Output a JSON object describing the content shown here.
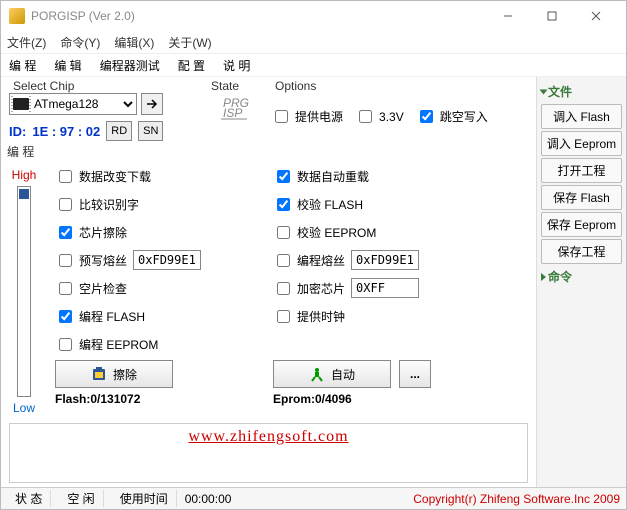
{
  "window": {
    "title": "PORGISP (Ver 2.0)"
  },
  "menu": {
    "file": "文件(Z)",
    "cmd": "命令(Y)",
    "edit": "编辑(X)",
    "about": "关于(W)"
  },
  "toolbar": {
    "prog": "编 程",
    "edit": "编  辑",
    "test": "编程器测试",
    "config": "配  置",
    "help": "说  明"
  },
  "chip": {
    "group": "Select Chip",
    "selected": "ATmega128",
    "idlabel": "ID:",
    "idvalue": "1E : 97 : 02",
    "rd": "RD",
    "sn": "SN"
  },
  "state": {
    "label": "State"
  },
  "options": {
    "label": "Options",
    "power": "提供电源",
    "v33": "3.3V",
    "skip": "跳空写入",
    "power_chk": false,
    "v33_chk": false,
    "skip_chk": true
  },
  "programming": {
    "title": "编 程",
    "high": "High",
    "low": "Low",
    "left": [
      {
        "label": "数据改变下载",
        "chk": false
      },
      {
        "label": "比较识别字",
        "chk": false
      },
      {
        "label": "芯片擦除",
        "chk": true
      },
      {
        "label": "预写熔丝",
        "chk": false,
        "val": "0xFD99E1"
      },
      {
        "label": "空片检查",
        "chk": false
      },
      {
        "label": "编程 FLASH",
        "chk": true
      },
      {
        "label": "编程 EEPROM",
        "chk": false
      }
    ],
    "right": [
      {
        "label": "数据自动重载",
        "chk": true
      },
      {
        "label": "校验 FLASH",
        "chk": true
      },
      {
        "label": "校验 EEPROM",
        "chk": false
      },
      {
        "label": "编程熔丝",
        "chk": false,
        "val": "0xFD99E1"
      },
      {
        "label": "加密芯片",
        "chk": false,
        "val": "0XFF"
      },
      {
        "label": "提供时钟",
        "chk": false
      }
    ],
    "erase": "擦除",
    "auto": "自动",
    "dots": "...",
    "flashstat": "Flash:0/131072",
    "epromstat": "Eprom:0/4096"
  },
  "url": "www.zhifengsoft.com",
  "side": {
    "files": "文件",
    "buttons": [
      "调入 Flash",
      "调入 Eeprom",
      "打开工程",
      "保存 Flash",
      "保存 Eeprom",
      "保存工程"
    ],
    "cmds": "命令"
  },
  "status": {
    "state": "状 态",
    "idle": "空 闲",
    "timelbl": "使用时间",
    "time": "00:00:00",
    "copy": "Copyright(r) Zhifeng Software.Inc 2009"
  }
}
